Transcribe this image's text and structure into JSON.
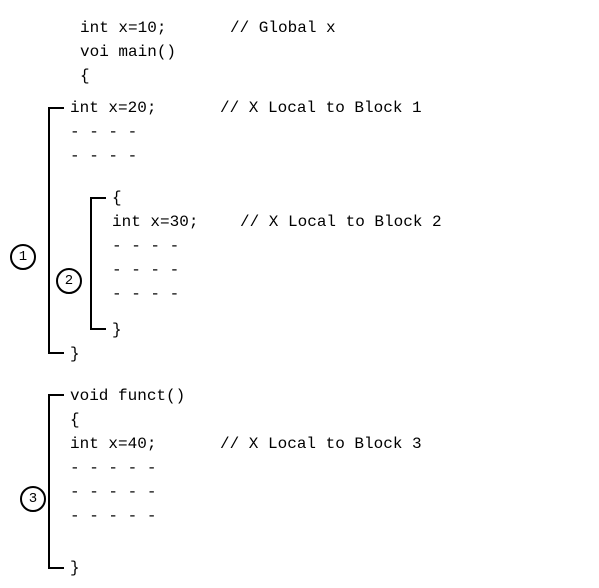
{
  "lines": {
    "l0": "int x=10;",
    "c0": "// Global x",
    "l1": "voi main()",
    "l2": "{",
    "l3": "int x=20;",
    "c3": "// X Local to Block 1",
    "l4": "- - - -",
    "l5": "- - - -",
    "l6": "{",
    "l7": "int x=30;",
    "c7": "// X Local to Block 2",
    "l8": "- - - -",
    "l9": "- - - -",
    "l10": "- - - -",
    "l11": "}",
    "l12": "}",
    "l13": "void funct()",
    "l14": "{",
    "l15": "int x=40;",
    "c15": "// X Local to Block 3",
    "l16": "- - - - -",
    "l17": "- - - - -",
    "l18": "- - - - -",
    "l19": "}"
  },
  "labels": {
    "b1": "1",
    "b2": "2",
    "b3": "3"
  }
}
